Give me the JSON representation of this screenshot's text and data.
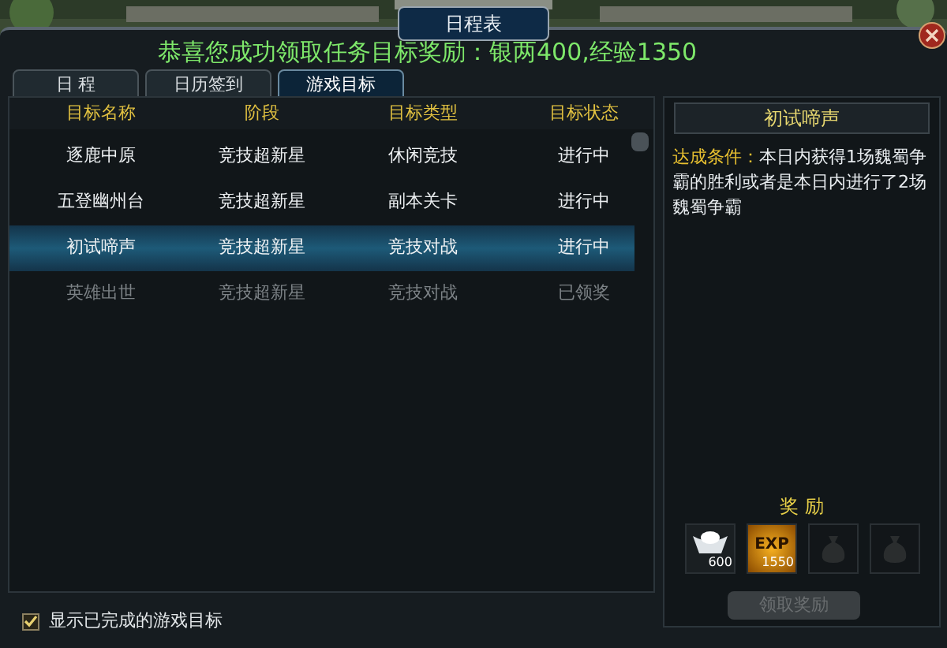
{
  "window": {
    "title": "日程表"
  },
  "notification": "恭喜您成功领取任务目标奖励：银两400,经验1350",
  "tabs": [
    {
      "label": "日 程",
      "selected": false
    },
    {
      "label": "日历签到",
      "selected": false
    },
    {
      "label": "游戏目标",
      "selected": true
    }
  ],
  "table": {
    "columns": [
      "目标名称",
      "阶段",
      "目标类型",
      "目标状态"
    ],
    "rows": [
      {
        "cells": [
          "逐鹿中原",
          "竞技超新星",
          "休闲竞技",
          "进行中"
        ],
        "selected": false,
        "completed": false
      },
      {
        "cells": [
          "五登幽州台",
          "竞技超新星",
          "副本关卡",
          "进行中"
        ],
        "selected": false,
        "completed": false
      },
      {
        "cells": [
          "初试啼声",
          "竞技超新星",
          "竞技对战",
          "进行中"
        ],
        "selected": true,
        "completed": false
      },
      {
        "cells": [
          "英雄出世",
          "竞技超新星",
          "竞技对战",
          "已领奖"
        ],
        "selected": false,
        "completed": true
      }
    ]
  },
  "detail": {
    "title": "初试啼声",
    "condition_label": "达成条件：",
    "condition": "本日内获得1场魏蜀争霸的胜利或者是本日内进行了2场魏蜀争霸",
    "reward_heading": "奖 励",
    "rewards": [
      {
        "kind": "silver",
        "amount": "600"
      },
      {
        "kind": "exp",
        "label": "EXP",
        "amount": "1550"
      },
      {
        "kind": "empty"
      },
      {
        "kind": "empty"
      }
    ],
    "claim_button": {
      "label": "领取奖励",
      "disabled": true
    }
  },
  "show_completed": {
    "label": "显示已完成的游戏目标",
    "checked": true
  }
}
